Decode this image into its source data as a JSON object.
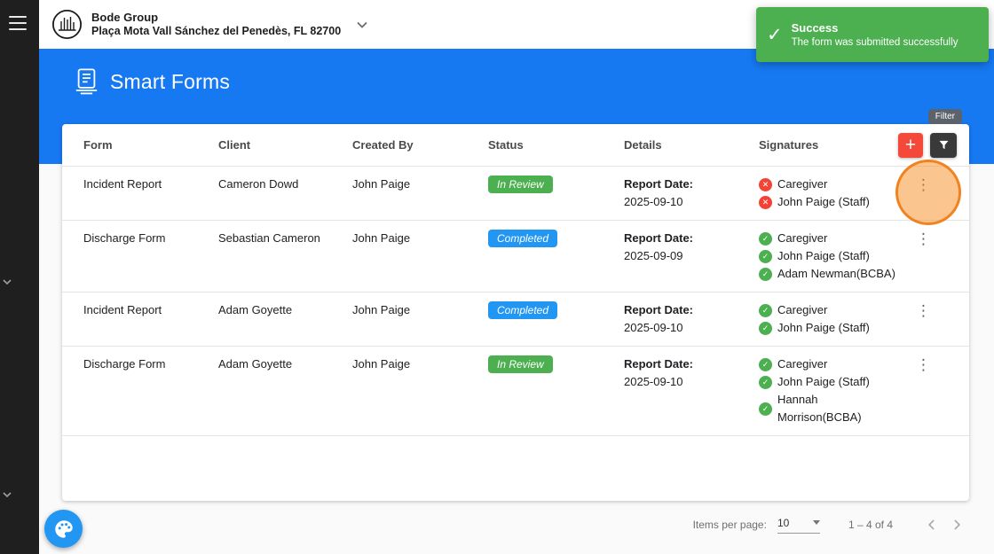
{
  "colors": {
    "accent_blue": "#1779f2",
    "toast_green": "#4caf50",
    "success_green": "#4caf50",
    "completed_blue": "#2196f3",
    "error_red": "#f44336",
    "add_red": "#f4483a",
    "highlight_orange": "rgba(246,139,30,0.5)"
  },
  "icons": {
    "plus_glyph": "+",
    "kebab_glyph": "⋮",
    "check_glyph": "✓",
    "cross_glyph": "✕"
  },
  "topbar": {
    "company_name": "Bode Group",
    "company_address": "Plaça Mota Vall Sánchez del Penedès, FL 82700"
  },
  "toast": {
    "title": "Success",
    "message": "The form was submitted successfully"
  },
  "page": {
    "title": "Smart Forms"
  },
  "filter_tooltip": "Filter",
  "table": {
    "columns": [
      "Form",
      "Client",
      "Created By",
      "Status",
      "Details",
      "Signatures"
    ],
    "rows": [
      {
        "form": "Incident Report",
        "client": "Cameron Dowd",
        "created_by": "John Paige",
        "status": "In Review",
        "status_type": "in-review",
        "details_label": "Report Date:",
        "report_date": "2025-09-10",
        "signatures": [
          {
            "name": "Caregiver",
            "signed": false
          },
          {
            "name": "John Paige (Staff)",
            "signed": false
          }
        ]
      },
      {
        "form": "Discharge Form",
        "client": "Sebastian Cameron",
        "created_by": "John Paige",
        "status": "Completed",
        "status_type": "completed",
        "details_label": "Report Date:",
        "report_date": "2025-09-09",
        "signatures": [
          {
            "name": "Caregiver",
            "signed": true
          },
          {
            "name": "John Paige (Staff)",
            "signed": true
          },
          {
            "name": "Adam Newman(BCBA)",
            "signed": true
          }
        ]
      },
      {
        "form": "Incident Report",
        "client": "Adam Goyette",
        "created_by": "John Paige",
        "status": "Completed",
        "status_type": "completed",
        "details_label": "Report Date:",
        "report_date": "2025-09-10",
        "signatures": [
          {
            "name": "Caregiver",
            "signed": true
          },
          {
            "name": "John Paige (Staff)",
            "signed": true
          }
        ]
      },
      {
        "form": "Discharge Form",
        "client": "Adam Goyette",
        "created_by": "John Paige",
        "status": "In Review",
        "status_type": "in-review",
        "details_label": "Report Date:",
        "report_date": "2025-09-10",
        "signatures": [
          {
            "name": "Caregiver",
            "signed": true
          },
          {
            "name": "John Paige (Staff)",
            "signed": true
          },
          {
            "name": "Hannah Morrison(BCBA)",
            "signed": true
          }
        ]
      }
    ]
  },
  "pagination": {
    "items_per_page_label": "Items per page:",
    "items_per_page_value": "10",
    "range": "1 – 4 of 4"
  }
}
